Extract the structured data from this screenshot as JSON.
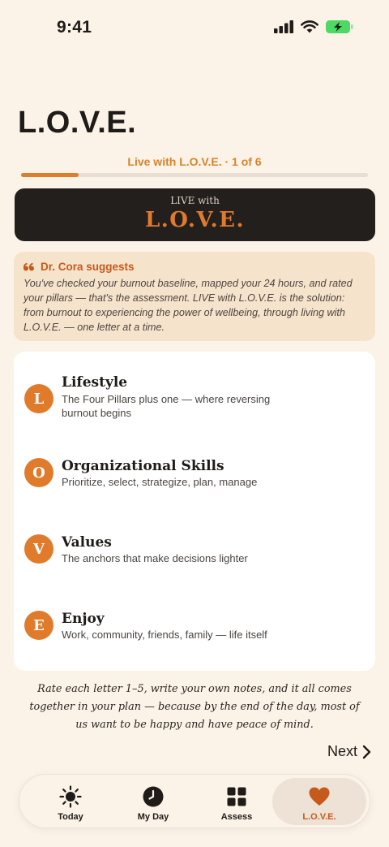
{
  "status_bar": {
    "time": "9:41"
  },
  "page": {
    "title": "L.O.V.E.",
    "progress": {
      "label": "Live with L.O.V.E. · 1 of 6",
      "fraction": 0.1667
    }
  },
  "banner": {
    "small": "LIVE with",
    "big": "L.O.V.E."
  },
  "suggestion": {
    "author": "Dr. Cora suggests",
    "text": "You've checked your burnout baseline, mapped your 24 hours, and rated your pillars — that's the assessment. LIVE with L.O.V.E. is the solution: from burnout to experiencing the power of wellbeing, through living with L.O.V.E. — one letter at a time."
  },
  "letters": [
    {
      "letter": "L",
      "title": "Lifestyle",
      "subtitle": "The Four Pillars plus one — where reversing burnout begins"
    },
    {
      "letter": "O",
      "title": "Organizational Skills",
      "subtitle": "Prioritize, select, strategize, plan, manage"
    },
    {
      "letter": "V",
      "title": "Values",
      "subtitle": "The anchors that make decisions lighter"
    },
    {
      "letter": "E",
      "title": "Enjoy",
      "subtitle": "Work, community, friends, family — life itself"
    }
  ],
  "footer": {
    "text": "Rate each letter 1–5, write your own notes, and it all comes together in your plan — because by the end of the day, most of us want to be happy and have peace of mind."
  },
  "next_label": "Next",
  "tabs": [
    {
      "label": "Today",
      "icon": "sun-icon"
    },
    {
      "label": "My Day",
      "icon": "clock-icon"
    },
    {
      "label": "Assess",
      "icon": "grid-icon"
    },
    {
      "label": "L.O.V.E.",
      "icon": "heart-icon",
      "active": true
    }
  ],
  "colors": {
    "accent": "#E07B2C",
    "background": "#FBF3E8",
    "banner": "#231F1C",
    "suggestion_bg": "#F6E3CC"
  }
}
